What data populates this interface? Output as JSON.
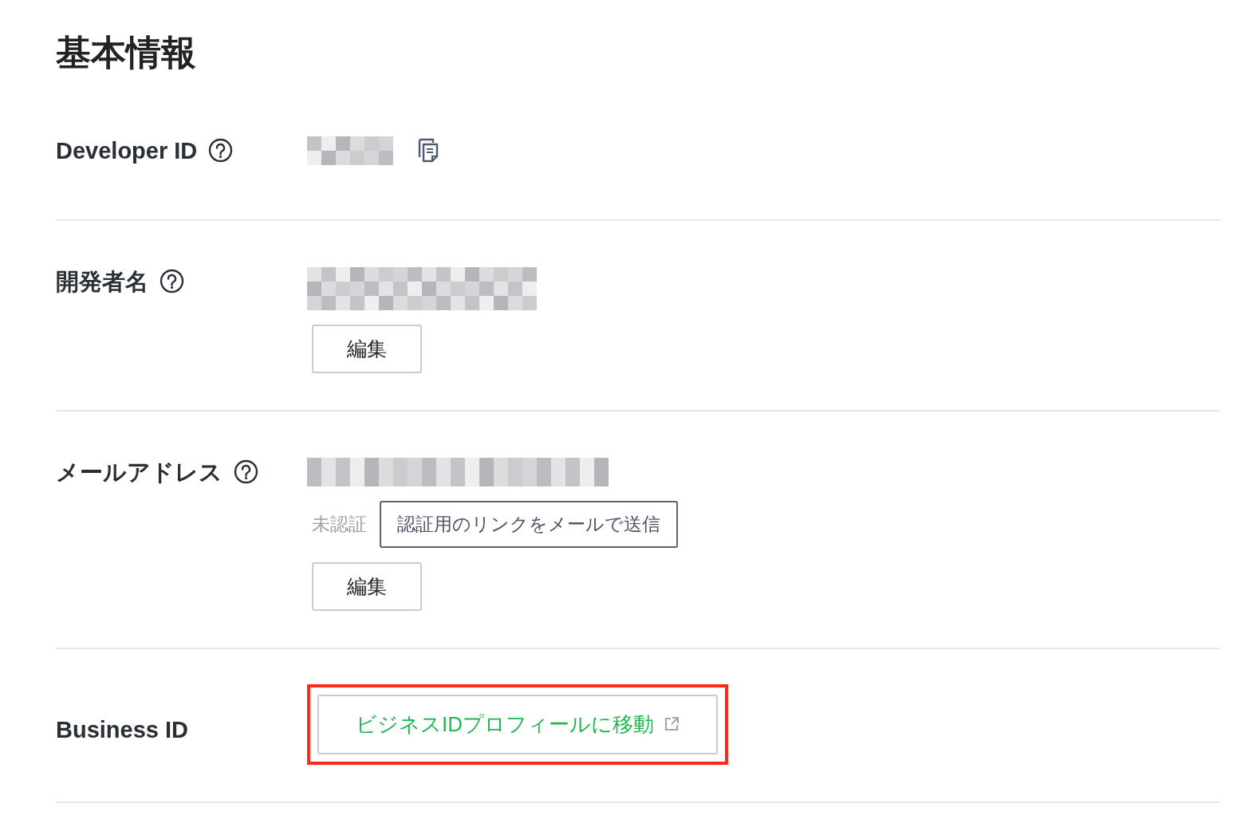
{
  "title": "基本情報",
  "rows": [
    {
      "kind": "copyable",
      "label": "Developer ID",
      "help": true,
      "redacted": true
    },
    {
      "kind": "editable",
      "label": "開発者名",
      "help": true,
      "redacted": true,
      "edit_button": "編集"
    },
    {
      "kind": "email",
      "label": "メールアドレス",
      "help": true,
      "redacted": true,
      "status": "未認証",
      "verify_button": "認証用のリンクをメールで送信",
      "edit_button": "編集"
    },
    {
      "kind": "link",
      "label": "Business ID",
      "help": false,
      "link_button": "ビジネスIDプロフィールに移動",
      "external": true,
      "highlighted": true
    }
  ]
}
